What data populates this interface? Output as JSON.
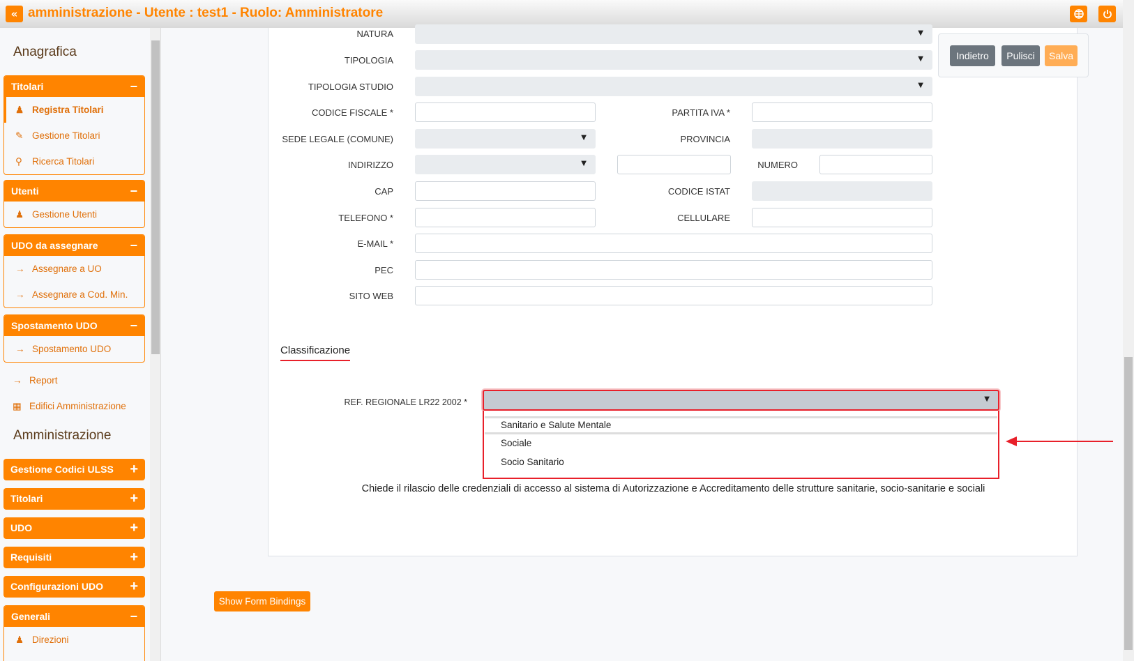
{
  "header": {
    "title": "amministrazione - Utente : test1 - Ruolo: Amministratore",
    "collapse_icon": "«",
    "globe_icon": "globe",
    "power_icon": "power"
  },
  "sidebar": {
    "section1": "Anagrafica",
    "groups": [
      {
        "label": "Titolari",
        "toggle": "−",
        "items": [
          {
            "icon": "user-edit",
            "label": "Registra Titolari"
          },
          {
            "icon": "edit",
            "label": "Gestione Titolari"
          },
          {
            "icon": "search",
            "label": "Ricerca Titolari"
          }
        ]
      },
      {
        "label": "Utenti",
        "toggle": "−",
        "items": [
          {
            "icon": "user-edit",
            "label": "Gestione Utenti"
          }
        ]
      },
      {
        "label": "UDO da assegnare",
        "toggle": "−",
        "items": [
          {
            "icon": "arrow-right",
            "label": "Assegnare a UO"
          },
          {
            "icon": "arrow-right",
            "label": "Assegnare a Cod. Min."
          }
        ]
      },
      {
        "label": "Spostamento UDO",
        "toggle": "−",
        "items": [
          {
            "icon": "arrow-right",
            "label": "Spostamento UDO"
          }
        ]
      }
    ],
    "links": [
      {
        "icon": "arrow-right",
        "label": "Report"
      },
      {
        "icon": "building",
        "label": "Edifici Amministrazione"
      }
    ],
    "section2": "Amministrazione",
    "admin_groups": [
      {
        "label": "Gestione Codici ULSS",
        "toggle": "+"
      },
      {
        "label": "Titolari",
        "toggle": "+"
      },
      {
        "label": "UDO",
        "toggle": "+"
      },
      {
        "label": "Requisiti",
        "toggle": "+"
      },
      {
        "label": "Configurazioni UDO",
        "toggle": "+"
      }
    ],
    "generali": {
      "label": "Generali",
      "toggle": "−",
      "items": [
        {
          "icon": "user-edit",
          "label": "Direzioni"
        }
      ]
    }
  },
  "form": {
    "natura": "NATURA",
    "tipologia": "TIPOLOGIA",
    "tipologia_studio": "TIPOLOGIA STUDIO",
    "codice_fiscale": "CODICE FISCALE *",
    "partita_iva": "PARTITA IVA *",
    "sede_legale": "SEDE LEGALE (COMUNE)",
    "provincia": "PROVINCIA",
    "indirizzo": "INDIRIZZO",
    "numero": "NUMERO",
    "cap": "CAP",
    "codice_istat": "CODICE ISTAT",
    "telefono": "TELEFONO *",
    "cellulare": "CELLULARE",
    "email": "E-MAIL *",
    "pec": "PEC",
    "sito_web": "SITO WEB"
  },
  "classificazione": {
    "title": "Classificazione",
    "ref_label": "REF. REGIONALE LR22 2002 *",
    "options": [
      "Sanitario e Salute Mentale",
      "Sociale",
      "Socio Sanitario"
    ],
    "description": "Chiede il rilascio delle credenziali di accesso al sistema di Autorizzazione e Accreditamento delle strutture sanitarie, socio-sanitarie e sociali"
  },
  "actions": {
    "back": "Indietro",
    "clear": "Pulisci",
    "save": "Salva"
  },
  "show_bindings": "Show Form Bindings",
  "colors": {
    "accent": "#ff8400",
    "highlight": "#e8202a",
    "secondary": "#6c757d"
  }
}
